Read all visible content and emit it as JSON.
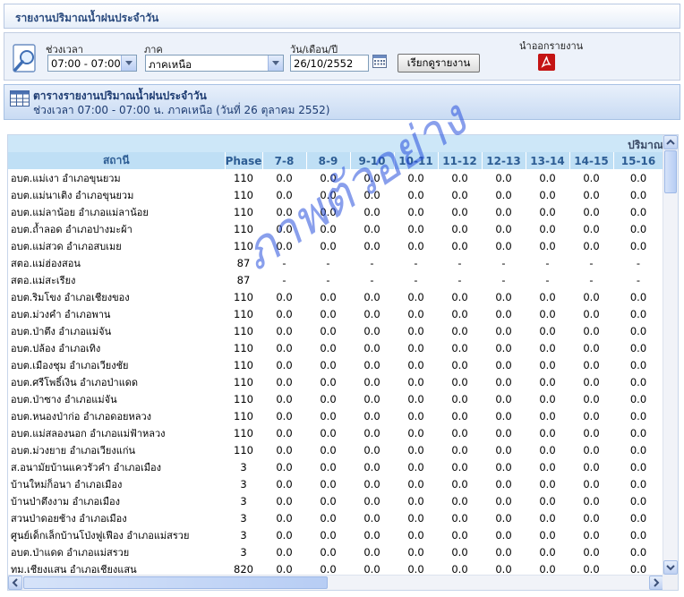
{
  "page_title": "รายงานปริมาณน้ำฝนประจำวัน",
  "filters": {
    "time_label": "ช่วงเวลา",
    "time_value": "07:00 - 07:00",
    "region_label": "ภาค",
    "region_value": "ภาคเหนือ",
    "date_label": "วัน/เดือน/ปี",
    "date_value": "26/10/2552",
    "submit_label": "เรียกดูรายงาน",
    "export_label": "นำออกรายงาน"
  },
  "section": {
    "title": "ตารางรายงานปริมาณน้ำฝนประจำวัน",
    "subtitle": "ช่วงเวลา 07:00 - 07:00 น. ภาคเหนือ (วันที่ 26 ตุลาคม 2552)"
  },
  "table": {
    "group_header": "ปริมาณ",
    "columns": [
      "สถานี",
      "Phase",
      "7-8",
      "8-9",
      "9-10",
      "10-11",
      "11-12",
      "12-13",
      "13-14",
      "14-15",
      "15-16"
    ],
    "rows": [
      [
        "อบต.แม่เงา   อำเภอขุนยวม",
        "110",
        "0.0",
        "0.0",
        "0.0",
        "0.0",
        "0.0",
        "0.0",
        "0.0",
        "0.0",
        "0.0"
      ],
      [
        "อบต.แม่นาเติง   อำเภอขุนยวม",
        "110",
        "0.0",
        "0.0",
        "0.0",
        "0.0",
        "0.0",
        "0.0",
        "0.0",
        "0.0",
        "0.0"
      ],
      [
        "อบต.แม่ลาน้อย   อำเภอแม่ลาน้อย",
        "110",
        "0.0",
        "0.0",
        "0.0",
        "0.0",
        "0.0",
        "0.0",
        "0.0",
        "0.0",
        "0.0"
      ],
      [
        "อบต.ถ้ำลอด   อำเภอปางมะผ้า",
        "110",
        "0.0",
        "0.0",
        "0.0",
        "0.0",
        "0.0",
        "0.0",
        "0.0",
        "0.0",
        "0.0"
      ],
      [
        "อบต.แม่สวด   อำเภอสบเมย",
        "110",
        "0.0",
        "0.0",
        "0.0",
        "0.0",
        "0.0",
        "0.0",
        "0.0",
        "0.0",
        "0.0"
      ],
      [
        "สตอ.แม่ฮ่องสอน",
        "87",
        "-",
        "-",
        "-",
        "-",
        "-",
        "-",
        "-",
        "-",
        "-"
      ],
      [
        "สตอ.แม่สะเรียง",
        "87",
        "-",
        "-",
        "-",
        "-",
        "-",
        "-",
        "-",
        "-",
        "-"
      ],
      [
        "อบต.ริมโขง   อำเภอเชียงของ",
        "110",
        "0.0",
        "0.0",
        "0.0",
        "0.0",
        "0.0",
        "0.0",
        "0.0",
        "0.0",
        "0.0"
      ],
      [
        "อบต.ม่วงคำ   อำเภอพาน",
        "110",
        "0.0",
        "0.0",
        "0.0",
        "0.0",
        "0.0",
        "0.0",
        "0.0",
        "0.0",
        "0.0"
      ],
      [
        "อบต.ป่าตึง   อำเภอแม่จัน",
        "110",
        "0.0",
        "0.0",
        "0.0",
        "0.0",
        "0.0",
        "0.0",
        "0.0",
        "0.0",
        "0.0"
      ],
      [
        "อบต.ปล้อง   อำเภอเทิง",
        "110",
        "0.0",
        "0.0",
        "0.0",
        "0.0",
        "0.0",
        "0.0",
        "0.0",
        "0.0",
        "0.0"
      ],
      [
        "อบต.เมืองชุม   อำเภอเวียงชัย",
        "110",
        "0.0",
        "0.0",
        "0.0",
        "0.0",
        "0.0",
        "0.0",
        "0.0",
        "0.0",
        "0.0"
      ],
      [
        "อบต.ศรีโพธิ์เงิน   อำเภอป่าแดด",
        "110",
        "0.0",
        "0.0",
        "0.0",
        "0.0",
        "0.0",
        "0.0",
        "0.0",
        "0.0",
        "0.0"
      ],
      [
        "อบต.ป่าซาง   อำเภอแม่จัน",
        "110",
        "0.0",
        "0.0",
        "0.0",
        "0.0",
        "0.0",
        "0.0",
        "0.0",
        "0.0",
        "0.0"
      ],
      [
        "อบต.หนองป่าก่อ   อำเภอดอยหลวง",
        "110",
        "0.0",
        "0.0",
        "0.0",
        "0.0",
        "0.0",
        "0.0",
        "0.0",
        "0.0",
        "0.0"
      ],
      [
        "อบต.แม่สลองนอก   อำเภอแม่ฟ้าหลวง",
        "110",
        "0.0",
        "0.0",
        "0.0",
        "0.0",
        "0.0",
        "0.0",
        "0.0",
        "0.0",
        "0.0"
      ],
      [
        "อบต.ม่วงยาย   อำเภอเวียงแก่น",
        "110",
        "0.0",
        "0.0",
        "0.0",
        "0.0",
        "0.0",
        "0.0",
        "0.0",
        "0.0",
        "0.0"
      ],
      [
        "ส.อนามัยบ้านแควรัวคำ   อำเภอเมือง",
        "3",
        "0.0",
        "0.0",
        "0.0",
        "0.0",
        "0.0",
        "0.0",
        "0.0",
        "0.0",
        "0.0"
      ],
      [
        "บ้านใหม่ก็อนา   อำเภอเมือง",
        "3",
        "0.0",
        "0.0",
        "0.0",
        "0.0",
        "0.0",
        "0.0",
        "0.0",
        "0.0",
        "0.0"
      ],
      [
        "บ้านป่าตึงงาม   อำเภอเมือง",
        "3",
        "0.0",
        "0.0",
        "0.0",
        "0.0",
        "0.0",
        "0.0",
        "0.0",
        "0.0",
        "0.0"
      ],
      [
        "สวนป่าดอยช้าง   อำเภอเมือง",
        "3",
        "0.0",
        "0.0",
        "0.0",
        "0.0",
        "0.0",
        "0.0",
        "0.0",
        "0.0",
        "0.0"
      ],
      [
        "ศูนย์เด็กเล็กบ้านโป่งฟูเฟือง   อำเภอแม่สรวย",
        "3",
        "0.0",
        "0.0",
        "0.0",
        "0.0",
        "0.0",
        "0.0",
        "0.0",
        "0.0",
        "0.0"
      ],
      [
        "อบต.ป่าแดด   อำเภอแม่สรวย",
        "3",
        "0.0",
        "0.0",
        "0.0",
        "0.0",
        "0.0",
        "0.0",
        "0.0",
        "0.0",
        "0.0"
      ],
      [
        "ทม.เชียงแสน   อำเภอเชียงแสน",
        "820",
        "0.0",
        "0.0",
        "0.0",
        "0.0",
        "0.0",
        "0.0",
        "0.0",
        "0.0",
        "0.0"
      ]
    ]
  },
  "watermark": "ภาพตัวอย่าง",
  "colors": {
    "header_bg": "#bfdff5",
    "header_text": "#2d5d94",
    "watermark": "#2850dc"
  },
  "icons": [
    "search-icon",
    "calendar-icon",
    "pdf-icon",
    "table-icon"
  ]
}
